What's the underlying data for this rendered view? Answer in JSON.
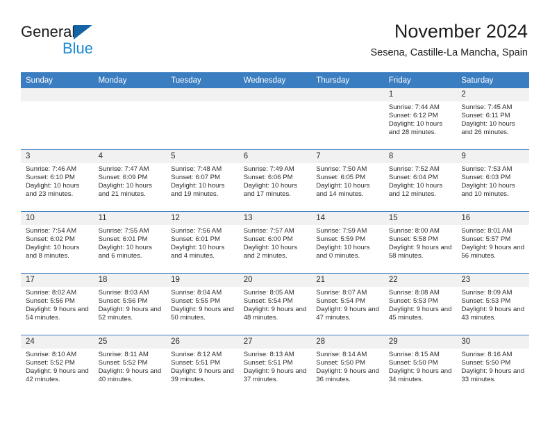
{
  "brand": {
    "name_top": "General",
    "name_bottom": "Blue",
    "logo_icon": "triangle-icon",
    "accent_color": "#1464a5",
    "blue_color": "#1e8bd6"
  },
  "header": {
    "month_title": "November 2024",
    "location": "Sesena, Castille-La Mancha, Spain"
  },
  "calendar": {
    "header_bg": "#3a7dc0",
    "daynum_bg": "#f1f1f1",
    "weekdays": [
      "Sunday",
      "Monday",
      "Tuesday",
      "Wednesday",
      "Thursday",
      "Friday",
      "Saturday"
    ],
    "weeks": [
      [
        {
          "day": "",
          "empty": true
        },
        {
          "day": "",
          "empty": true
        },
        {
          "day": "",
          "empty": true
        },
        {
          "day": "",
          "empty": true
        },
        {
          "day": "",
          "empty": true
        },
        {
          "day": "1",
          "sunrise": "Sunrise: 7:44 AM",
          "sunset": "Sunset: 6:12 PM",
          "daylight": "Daylight: 10 hours and 28 minutes."
        },
        {
          "day": "2",
          "sunrise": "Sunrise: 7:45 AM",
          "sunset": "Sunset: 6:11 PM",
          "daylight": "Daylight: 10 hours and 26 minutes."
        }
      ],
      [
        {
          "day": "3",
          "sunrise": "Sunrise: 7:46 AM",
          "sunset": "Sunset: 6:10 PM",
          "daylight": "Daylight: 10 hours and 23 minutes."
        },
        {
          "day": "4",
          "sunrise": "Sunrise: 7:47 AM",
          "sunset": "Sunset: 6:09 PM",
          "daylight": "Daylight: 10 hours and 21 minutes."
        },
        {
          "day": "5",
          "sunrise": "Sunrise: 7:48 AM",
          "sunset": "Sunset: 6:07 PM",
          "daylight": "Daylight: 10 hours and 19 minutes."
        },
        {
          "day": "6",
          "sunrise": "Sunrise: 7:49 AM",
          "sunset": "Sunset: 6:06 PM",
          "daylight": "Daylight: 10 hours and 17 minutes."
        },
        {
          "day": "7",
          "sunrise": "Sunrise: 7:50 AM",
          "sunset": "Sunset: 6:05 PM",
          "daylight": "Daylight: 10 hours and 14 minutes."
        },
        {
          "day": "8",
          "sunrise": "Sunrise: 7:52 AM",
          "sunset": "Sunset: 6:04 PM",
          "daylight": "Daylight: 10 hours and 12 minutes."
        },
        {
          "day": "9",
          "sunrise": "Sunrise: 7:53 AM",
          "sunset": "Sunset: 6:03 PM",
          "daylight": "Daylight: 10 hours and 10 minutes."
        }
      ],
      [
        {
          "day": "10",
          "sunrise": "Sunrise: 7:54 AM",
          "sunset": "Sunset: 6:02 PM",
          "daylight": "Daylight: 10 hours and 8 minutes."
        },
        {
          "day": "11",
          "sunrise": "Sunrise: 7:55 AM",
          "sunset": "Sunset: 6:01 PM",
          "daylight": "Daylight: 10 hours and 6 minutes."
        },
        {
          "day": "12",
          "sunrise": "Sunrise: 7:56 AM",
          "sunset": "Sunset: 6:01 PM",
          "daylight": "Daylight: 10 hours and 4 minutes."
        },
        {
          "day": "13",
          "sunrise": "Sunrise: 7:57 AM",
          "sunset": "Sunset: 6:00 PM",
          "daylight": "Daylight: 10 hours and 2 minutes."
        },
        {
          "day": "14",
          "sunrise": "Sunrise: 7:59 AM",
          "sunset": "Sunset: 5:59 PM",
          "daylight": "Daylight: 10 hours and 0 minutes."
        },
        {
          "day": "15",
          "sunrise": "Sunrise: 8:00 AM",
          "sunset": "Sunset: 5:58 PM",
          "daylight": "Daylight: 9 hours and 58 minutes."
        },
        {
          "day": "16",
          "sunrise": "Sunrise: 8:01 AM",
          "sunset": "Sunset: 5:57 PM",
          "daylight": "Daylight: 9 hours and 56 minutes."
        }
      ],
      [
        {
          "day": "17",
          "sunrise": "Sunrise: 8:02 AM",
          "sunset": "Sunset: 5:56 PM",
          "daylight": "Daylight: 9 hours and 54 minutes."
        },
        {
          "day": "18",
          "sunrise": "Sunrise: 8:03 AM",
          "sunset": "Sunset: 5:56 PM",
          "daylight": "Daylight: 9 hours and 52 minutes."
        },
        {
          "day": "19",
          "sunrise": "Sunrise: 8:04 AM",
          "sunset": "Sunset: 5:55 PM",
          "daylight": "Daylight: 9 hours and 50 minutes."
        },
        {
          "day": "20",
          "sunrise": "Sunrise: 8:05 AM",
          "sunset": "Sunset: 5:54 PM",
          "daylight": "Daylight: 9 hours and 48 minutes."
        },
        {
          "day": "21",
          "sunrise": "Sunrise: 8:07 AM",
          "sunset": "Sunset: 5:54 PM",
          "daylight": "Daylight: 9 hours and 47 minutes."
        },
        {
          "day": "22",
          "sunrise": "Sunrise: 8:08 AM",
          "sunset": "Sunset: 5:53 PM",
          "daylight": "Daylight: 9 hours and 45 minutes."
        },
        {
          "day": "23",
          "sunrise": "Sunrise: 8:09 AM",
          "sunset": "Sunset: 5:53 PM",
          "daylight": "Daylight: 9 hours and 43 minutes."
        }
      ],
      [
        {
          "day": "24",
          "sunrise": "Sunrise: 8:10 AM",
          "sunset": "Sunset: 5:52 PM",
          "daylight": "Daylight: 9 hours and 42 minutes."
        },
        {
          "day": "25",
          "sunrise": "Sunrise: 8:11 AM",
          "sunset": "Sunset: 5:52 PM",
          "daylight": "Daylight: 9 hours and 40 minutes."
        },
        {
          "day": "26",
          "sunrise": "Sunrise: 8:12 AM",
          "sunset": "Sunset: 5:51 PM",
          "daylight": "Daylight: 9 hours and 39 minutes."
        },
        {
          "day": "27",
          "sunrise": "Sunrise: 8:13 AM",
          "sunset": "Sunset: 5:51 PM",
          "daylight": "Daylight: 9 hours and 37 minutes."
        },
        {
          "day": "28",
          "sunrise": "Sunrise: 8:14 AM",
          "sunset": "Sunset: 5:50 PM",
          "daylight": "Daylight: 9 hours and 36 minutes."
        },
        {
          "day": "29",
          "sunrise": "Sunrise: 8:15 AM",
          "sunset": "Sunset: 5:50 PM",
          "daylight": "Daylight: 9 hours and 34 minutes."
        },
        {
          "day": "30",
          "sunrise": "Sunrise: 8:16 AM",
          "sunset": "Sunset: 5:50 PM",
          "daylight": "Daylight: 9 hours and 33 minutes."
        }
      ]
    ]
  }
}
